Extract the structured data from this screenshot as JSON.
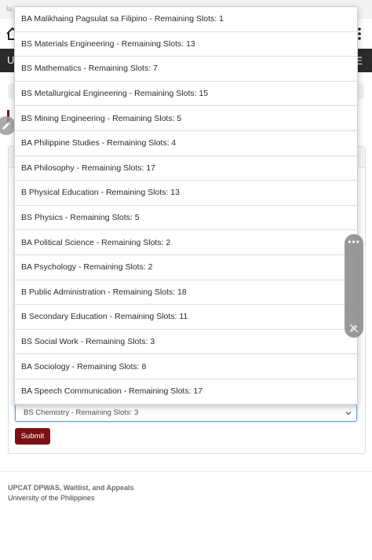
{
  "status_bar": {
    "text": "lu..."
  },
  "app_header": {
    "title": "Ul",
    "menu_label": "E"
  },
  "dropdown": {
    "options": [
      "BA Malikhaing Pagsulat sa Filipino - Remaining Slots: 1",
      "BS Materials Engineering - Remaining Slots: 13",
      "BS Mathematics - Remaining Slots: 7",
      "BS Metallurgical Engineering - Remaining Slots: 15",
      "BS Mining Engineering - Remaining Slots: 5",
      "BA Philippine Studies - Remaining Slots: 4",
      "BA Philosophy - Remaining Slots: 17",
      "B Physical Education - Remaining Slots: 13",
      "BS Physics - Remaining Slots: 5",
      "BA Political Science - Remaining Slots: 2",
      "BA Psychology - Remaining Slots: 2",
      "B Public Administration - Remaining Slots: 18",
      "B Secondary Education - Remaining Slots: 11",
      "BS Social Work - Remaining Slots: 3",
      "BA Sociology - Remaining Slots: 8",
      "BA Speech Communication - Remaining Slots: 17"
    ]
  },
  "form": {
    "selected_value": "BS Chemistry - Remaining Slots: 3",
    "submit_label": "Submit"
  },
  "footer": {
    "title": "UPCAT DPWAS, Waitlist, and Appeals",
    "subtitle": "University of the Philippines"
  },
  "side_toolbar": {
    "more_label": "•••"
  },
  "colors": {
    "brand_maroon": "#7b1113",
    "header_dark": "#2a2a2a",
    "focus_blue": "#5b9bd5"
  }
}
